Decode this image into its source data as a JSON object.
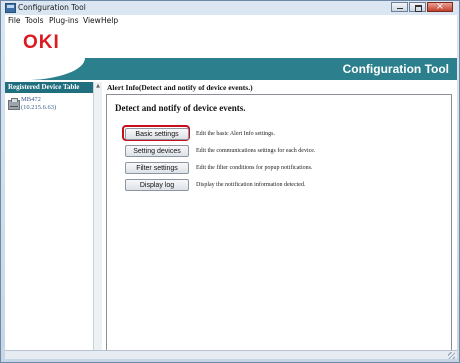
{
  "window": {
    "title": "Configuration Tool"
  },
  "menubar": {
    "items": [
      "File",
      "Tools",
      "Plug-ins",
      "View",
      "Help"
    ]
  },
  "header": {
    "logo": "OKI",
    "app_title": "Configuration Tool"
  },
  "left_pane": {
    "header": "Registered Device Table",
    "devices": [
      {
        "name": "MB472",
        "ip": "(10.215.6.63)"
      }
    ]
  },
  "right_pane": {
    "section_title": "Alert Info(Detect and notify of device events.)",
    "heading": "Detect and notify of device events.",
    "actions": [
      {
        "label": "Basic settings",
        "description": "Edit the basic Alert Info settings.",
        "highlighted": true
      },
      {
        "label": "Setting devices",
        "description": "Edit the communications settings for each device.",
        "highlighted": false
      },
      {
        "label": "Filter settings",
        "description": "Edit the filter conditions for popup notifications.",
        "highlighted": false
      },
      {
        "label": "Display log",
        "description": "Display the notification information detected.",
        "highlighted": false
      }
    ]
  },
  "colors": {
    "accent": "#2c7f8d",
    "logo": "#dd1a21",
    "highlight": "#c8101d"
  }
}
